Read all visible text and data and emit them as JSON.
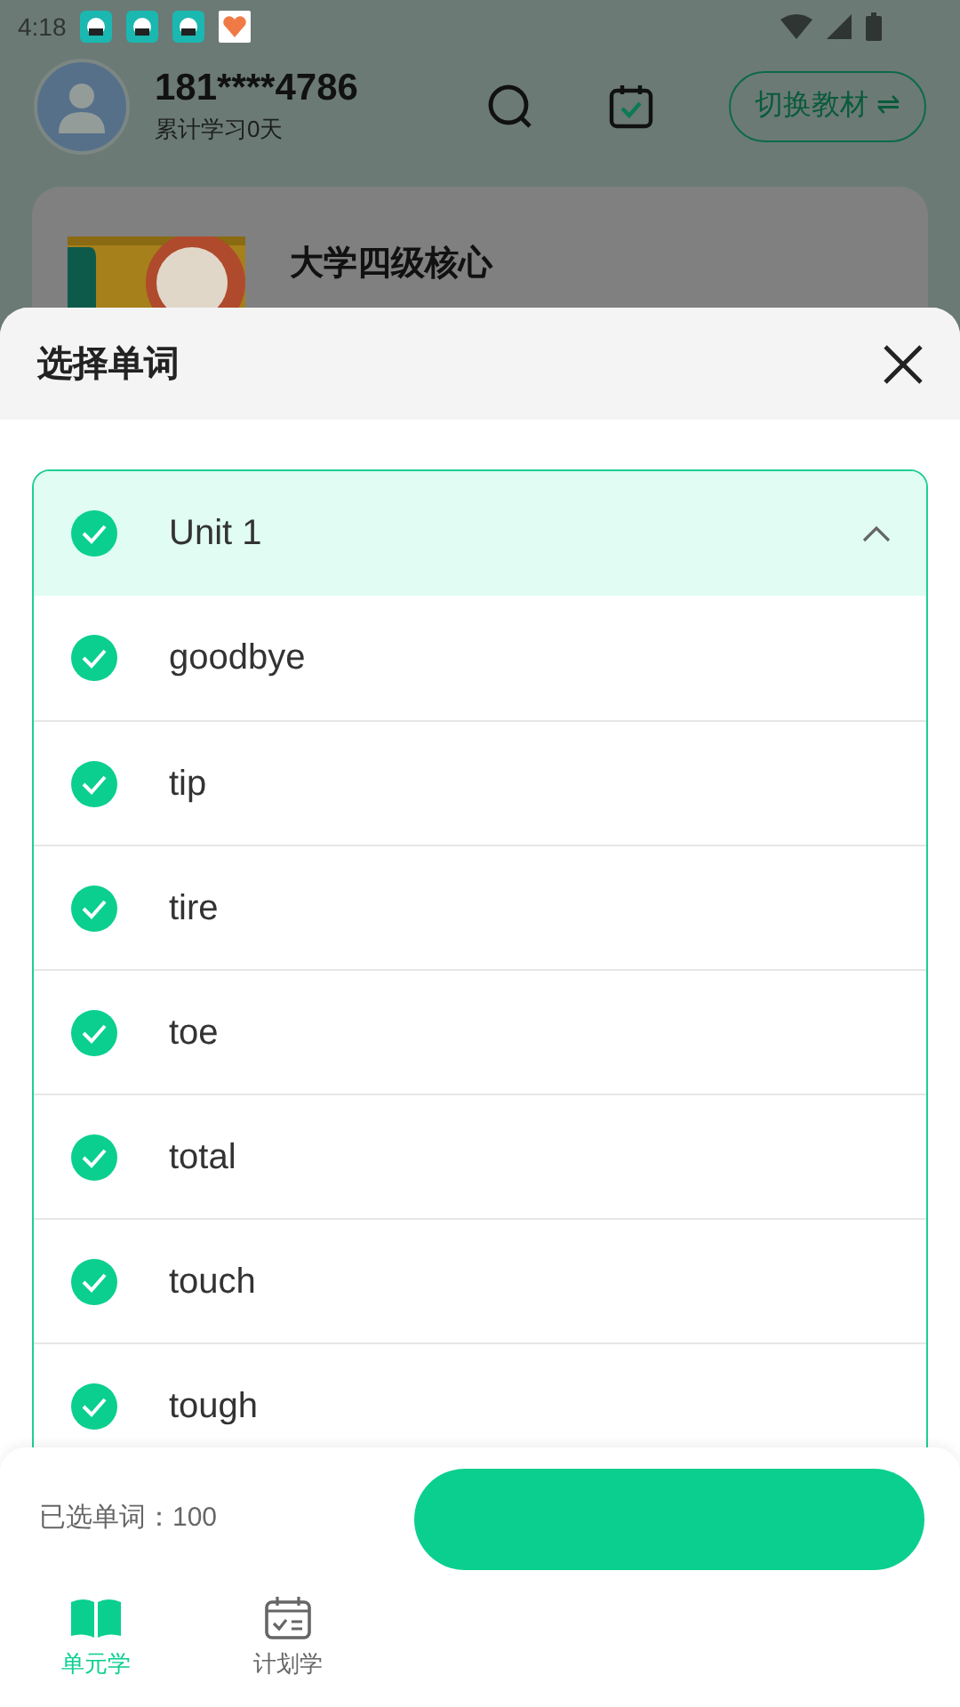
{
  "status_bar": {
    "time": "4:18"
  },
  "profile": {
    "phone": "181****4786",
    "study_days": "累计学习0天",
    "switch_button": "切换教材 ⇌"
  },
  "book": {
    "title": "大学四级核心"
  },
  "sheet": {
    "title": "选择单词",
    "unit": {
      "label": "Unit 1",
      "checked": true,
      "expanded": true
    },
    "words": [
      {
        "label": "goodbye",
        "checked": true
      },
      {
        "label": "tip",
        "checked": true
      },
      {
        "label": "tire",
        "checked": true
      },
      {
        "label": "toe",
        "checked": true
      },
      {
        "label": "total",
        "checked": true
      },
      {
        "label": "touch",
        "checked": true
      },
      {
        "label": "tough",
        "checked": true
      }
    ],
    "selected_count": "已选单词：100"
  },
  "nav": [
    {
      "label": "单元学",
      "kind": "book",
      "selected": true
    },
    {
      "label": "计划学",
      "kind": "calendar",
      "selected": false
    }
  ]
}
